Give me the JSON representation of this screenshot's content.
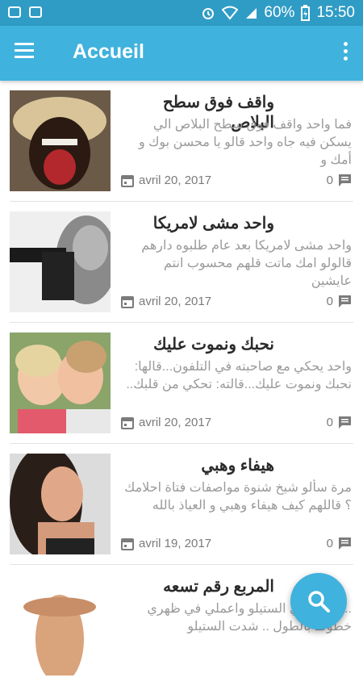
{
  "status_bar": {
    "battery": "60%",
    "time": "15:50"
  },
  "app_bar": {
    "title": "Accueil"
  },
  "posts": [
    {
      "title": "واقف فوق سطح البلاص",
      "excerpt": "فما واحد واقف فوق سطح البلاص الي يسكن فيه جاه واحد قالو يا محسن بوك و أمك و",
      "date": "avril 20, 2017",
      "comments": "0"
    },
    {
      "title": "واحد مشى لامريكا",
      "excerpt": "واحد مشى لامريكا بعد عام طلبوه دارهم قالولو امك ماتت قلهم محسوب انتم عايشين",
      "date": "avril 20, 2017",
      "comments": "0"
    },
    {
      "title": "نحبك ونموت عليك",
      "excerpt": "واحد يحكي مع صاحبته في التلفون...قالها: نحبك ونموت عليك...قالته: تحكي من قلبك..",
      "date": "avril 20, 2017",
      "comments": "0"
    },
    {
      "title": "هيفاء وهبي",
      "excerpt": "مرة سألو شيخ شنوة مواصفات فتاة احلامك ؟ قاللهم كيف هيفاء وهبي و العياذ بالله",
      "date": "avril 19, 2017",
      "comments": "0"
    },
    {
      "title": "المربع رقم تسعه",
      "excerpt": "...رتو: شدي الستيلو واعملي في ظهري خطوط بالطول .. شدت الستيلو",
      "date": "",
      "comments": ""
    }
  ],
  "colors": {
    "status_bar": "#2f9cc5",
    "app_bar": "#3fb2dd",
    "fab": "#3fb2dd"
  },
  "icons": {
    "menu": "hamburger-menu-icon",
    "more": "more-vert-icon",
    "date": "calendar-icon",
    "comments": "comment-icon",
    "fab": "search-icon"
  }
}
